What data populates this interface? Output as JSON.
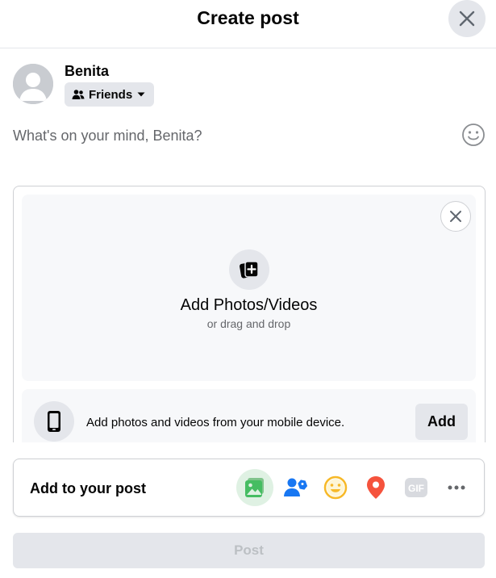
{
  "header": {
    "title": "Create post"
  },
  "user": {
    "name": "Benita",
    "audience": "Friends"
  },
  "composer": {
    "placeholder": "What's on your mind, Benita?"
  },
  "media": {
    "title": "Add Photos/Videos",
    "subtitle": "or drag and drop",
    "mobile_text": "Add photos and videos from your mobile device.",
    "mobile_add_label": "Add"
  },
  "add_to_post": {
    "label": "Add to your post",
    "tools": [
      {
        "name": "photo-video",
        "icon": "photo-icon",
        "color": "#45bd62",
        "active": true
      },
      {
        "name": "tag-people",
        "icon": "tag-people-icon",
        "color": "#1877f2"
      },
      {
        "name": "feeling-activity",
        "icon": "smiley-icon",
        "color": "#f7b928"
      },
      {
        "name": "check-in",
        "icon": "location-pin-icon",
        "color": "#f5533d"
      },
      {
        "name": "gif",
        "icon": "gif-icon",
        "color": "#bcc0c4"
      },
      {
        "name": "more",
        "icon": "more-icon",
        "color": "#65676b"
      }
    ]
  },
  "post_button": {
    "label": "Post"
  },
  "colors": {
    "accent_blue": "#1877f2",
    "surface": "#f7f8fa",
    "button_gray": "#e4e6eb",
    "secondary_text": "#65676b"
  }
}
